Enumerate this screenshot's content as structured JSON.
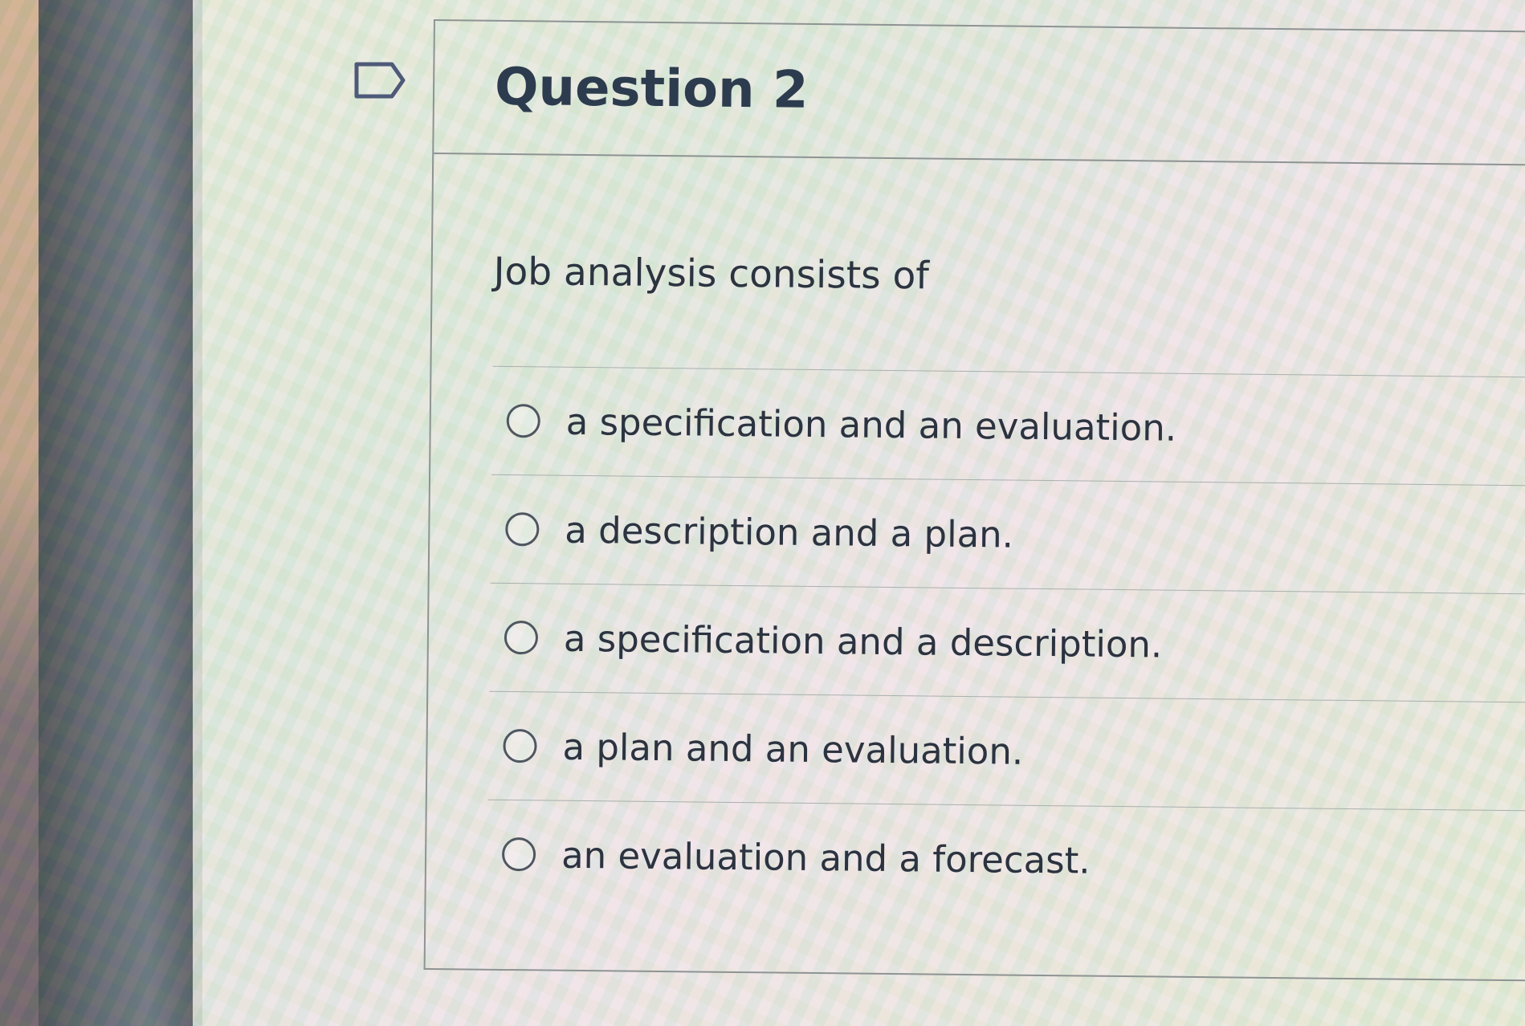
{
  "question": {
    "title": "Question 2",
    "prompt": "Job analysis consists of",
    "options": [
      "a specification and an evaluation.",
      "a description and a plan.",
      "a specification and a description.",
      "a plan and an evaluation.",
      "an evaluation and a forecast."
    ]
  },
  "icons": {
    "flag": "flag-question-icon",
    "radio": "radio-button-icon"
  },
  "colors": {
    "title": "#2d3b4e",
    "text": "#2c3340",
    "border": "#8e9393"
  }
}
